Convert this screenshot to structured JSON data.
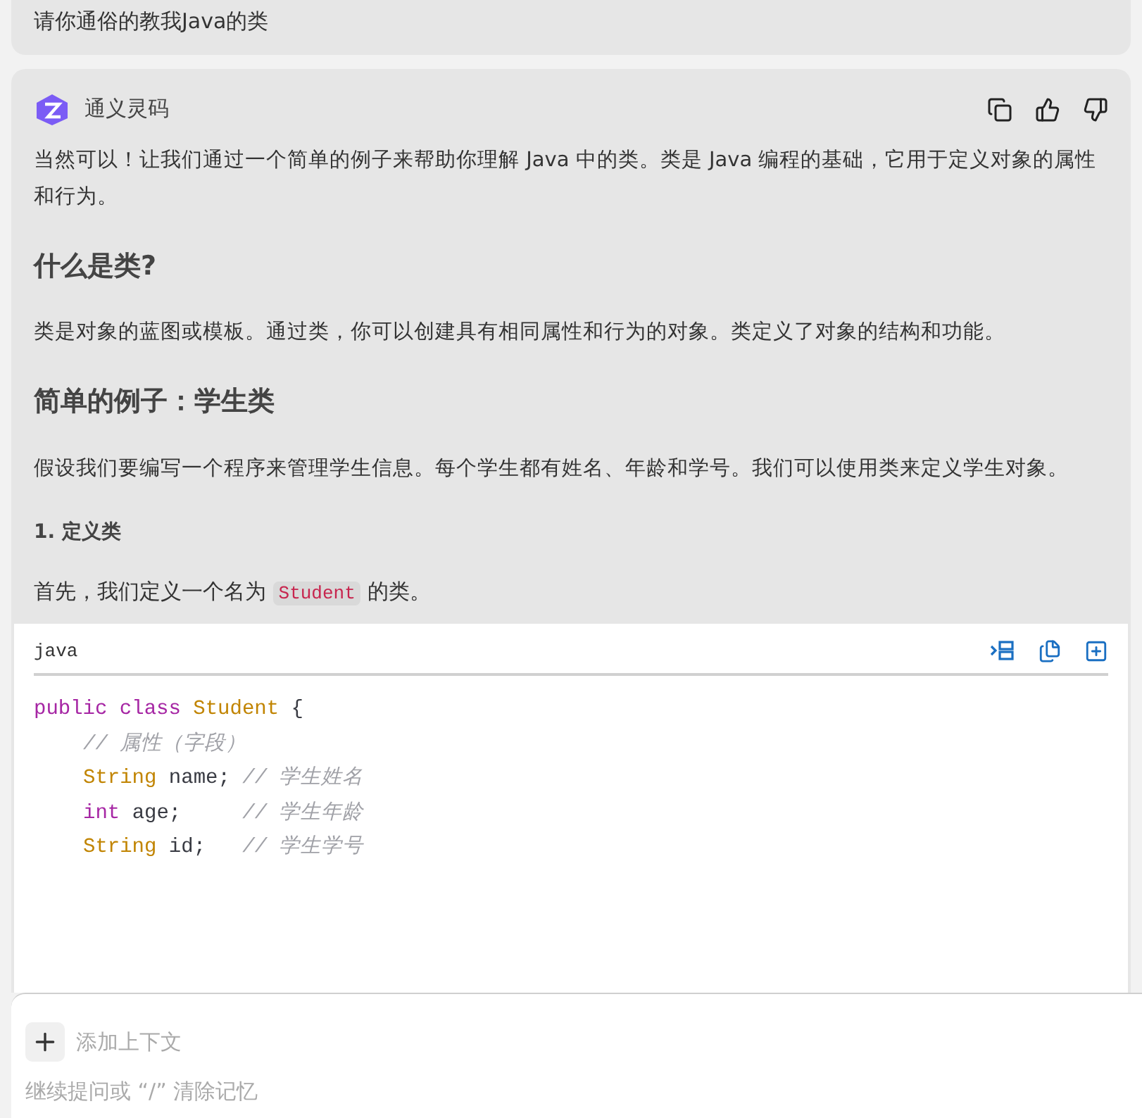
{
  "user_message": "请你通俗的教我Java的类",
  "assistant": {
    "name": "通义灵码",
    "blocks": [
      {
        "kind": "para",
        "text": "当然可以！让我们通过一个简单的例子来帮助你理解 Java 中的类。类是 Java 编程的基础，它用于定义对象的属性和行为。"
      },
      {
        "kind": "h2",
        "text": "什么是类?"
      },
      {
        "kind": "para",
        "text": "类是对象的蓝图或模板。通过类，你可以创建具有相同属性和行为的对象。类定义了对象的结构和功能。"
      },
      {
        "kind": "h2",
        "text": "简单的例子：学生类"
      },
      {
        "kind": "para",
        "text": "假设我们要编写一个程序来管理学生信息。每个学生都有姓名、年龄和学号。我们可以使用类来定义学生对象。"
      },
      {
        "kind": "h4",
        "text": "1. 定义类"
      },
      {
        "kind": "para_code",
        "before": "首先，我们定义一个名为 ",
        "code": "Student",
        "after": " 的类。"
      }
    ],
    "code_block": {
      "language": "java",
      "lines": [
        {
          "indent": false,
          "tokens": [
            {
              "kind": "keyword",
              "text": "public "
            },
            {
              "kind": "keyword",
              "text": "class "
            },
            {
              "kind": "type",
              "text": "Student "
            },
            {
              "kind": "plain",
              "text": "{"
            }
          ]
        },
        {
          "indent": true,
          "tokens": [
            {
              "kind": "comment",
              "text": "// 属性（字段）"
            }
          ]
        },
        {
          "indent": true,
          "tokens": [
            {
              "kind": "type",
              "text": "String "
            },
            {
              "kind": "plain",
              "text": "name; "
            },
            {
              "kind": "comment",
              "text": "// 学生姓名"
            }
          ]
        },
        {
          "indent": true,
          "tokens": [
            {
              "kind": "keyword",
              "text": "int "
            },
            {
              "kind": "plain",
              "text": "age;     "
            },
            {
              "kind": "comment",
              "text": "// 学生年龄"
            }
          ]
        },
        {
          "indent": true,
          "tokens": [
            {
              "kind": "type",
              "text": "String "
            },
            {
              "kind": "plain",
              "text": "id;   "
            },
            {
              "kind": "comment",
              "text": "// 学生学号"
            }
          ]
        }
      ]
    }
  },
  "input": {
    "context_label": "添加上下文",
    "placeholder": "继续提问或 “/” 清除记忆"
  }
}
